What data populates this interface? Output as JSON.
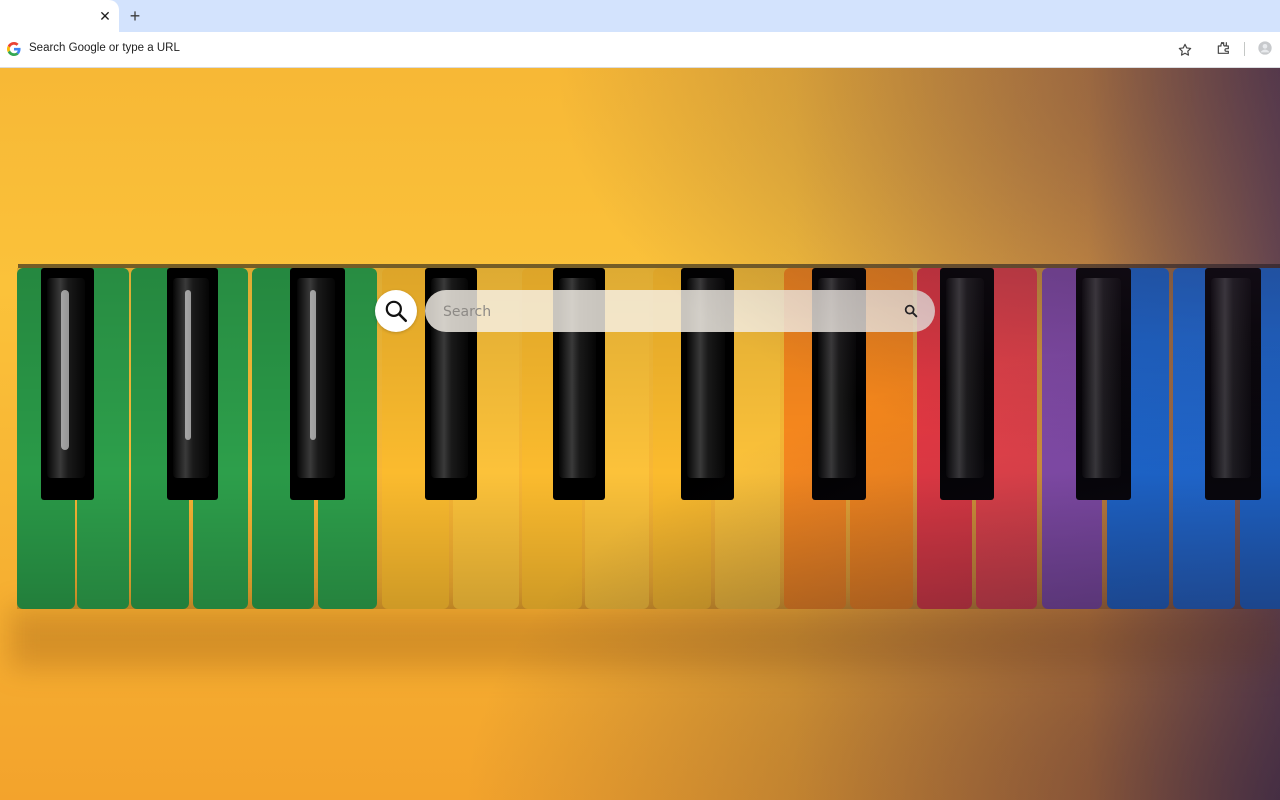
{
  "browser": {
    "tab_title": "",
    "close_glyph": "✕",
    "newtab_glyph": "+",
    "omnibox_text": "Search Google or type a URL",
    "icons": [
      "google-g-icon",
      "star-icon",
      "extensions-icon",
      "profile-icon"
    ]
  },
  "search": {
    "placeholder": "Search",
    "icons": [
      "search-logo-icon",
      "search-icon"
    ]
  },
  "wallpaper": {
    "subject": "rainbow piano keyboard",
    "key_colors": [
      "#2a9a48",
      "#2a9a48",
      "#2a9a48",
      "#2a9a48",
      "#2a9a48",
      "#2a9a48",
      "#fbbb2e",
      "#fbbb2e",
      "#fbbb2e",
      "#fbbb2e",
      "#fbbb2e",
      "#fbbb2e",
      "#fb8a1e",
      "#fb8a1e",
      "#ee3a43",
      "#ee3a43",
      "#8a4fb3",
      "#1a6fe0",
      "#1a6fe0",
      "#1a6fe0"
    ],
    "black_key_color": "#111111"
  },
  "colors": {
    "tabstrip": "#d3e3fd",
    "toolbar": "#ffffff",
    "background": "#f6b334"
  }
}
